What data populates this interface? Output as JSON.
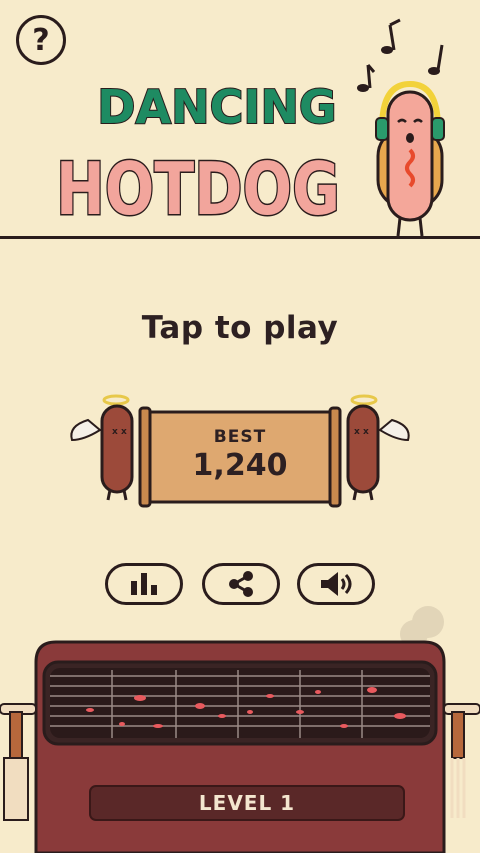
{
  "header": {
    "help_label": "?",
    "title_line1": "DANCING",
    "title_line2": "HOTDOG"
  },
  "main": {
    "tap_to_play": "Tap to play",
    "best_label": "BEST",
    "best_score": "1,240"
  },
  "buttons": {
    "leaderboard_icon": "bar-chart-icon",
    "share_icon": "share-icon",
    "sound_icon": "speaker-icon"
  },
  "grill": {
    "level_label": "LEVEL 1"
  },
  "colors": {
    "background": "#f7ebcb",
    "title_green": "#1e8b62",
    "title_pink": "#f2a59c",
    "outline": "#2a1c1c",
    "grill_body": "#8a3a3a",
    "scroll": "#dea870"
  }
}
